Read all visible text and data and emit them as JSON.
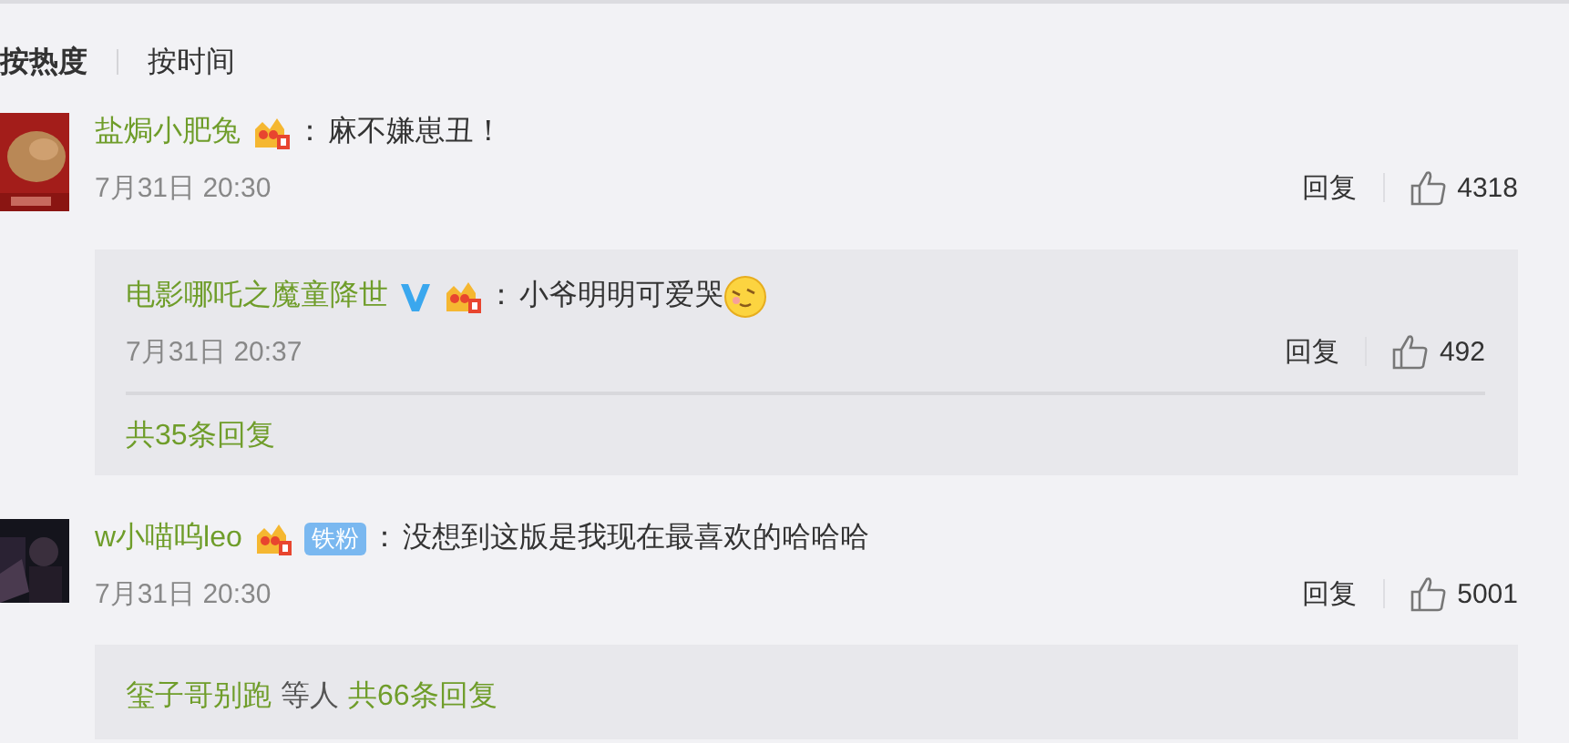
{
  "sort_tabs": [
    {
      "label": "按热度",
      "selected": true
    },
    {
      "label": "按时间",
      "selected": false
    }
  ],
  "comments": [
    {
      "user": "盐焗小肥兔",
      "badges": [
        {
          "kind": "crown"
        }
      ],
      "separator": "：",
      "text": "麻不嫌崽丑！",
      "time": "7月31日 20:30",
      "reply_label": "回复",
      "likes": "4318",
      "replies": [
        {
          "user": "电影哪吒之魔童降世",
          "badges": [
            {
              "kind": "verified"
            },
            {
              "kind": "crown"
            }
          ],
          "separator": "：",
          "text": "小爷明明可爱哭",
          "emoji": true,
          "time": "7月31日 20:37",
          "reply_label": "回复",
          "likes": "492"
        }
      ],
      "footer": {
        "count": "共35条回复"
      }
    },
    {
      "user": "w小喵呜leo",
      "badges": [
        {
          "kind": "crown"
        },
        {
          "kind": "fan",
          "label": "铁粉"
        }
      ],
      "separator": "：",
      "text": "没想到这版是我现在最喜欢的哈哈哈",
      "time": "7月31日 20:30",
      "reply_label": "回复",
      "likes": "5001",
      "footer": {
        "names": "玺子哥别跑",
        "suffix": "等人",
        "count": "共66条回复"
      }
    }
  ]
}
